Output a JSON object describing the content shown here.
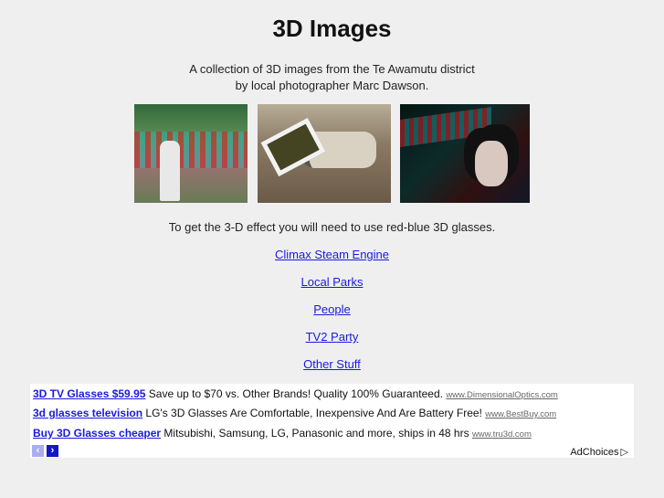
{
  "page": {
    "title": "3D Images",
    "intro_line1": "A collection of 3D images from the Te Awamutu district",
    "intro_line2": "by local photographer Marc Dawson.",
    "photos": [
      {
        "alt": "Anaglyph photo of person in front of steam engine"
      },
      {
        "alt": "3D glasses resting on a stereo camera"
      },
      {
        "alt": "Anaglyph portrait of a long-haired man"
      }
    ],
    "note": "To get the 3-D effect you will need to use red-blue 3D glasses.",
    "links": [
      "Climax Steam Engine",
      "Local Parks",
      "People",
      "TV2 Party",
      "Other Stuff"
    ]
  },
  "ads": {
    "items": [
      {
        "title": "3D TV Glasses $59.95",
        "text": "Save up to $70 vs. Other Brands! Quality 100% Guaranteed.",
        "url": "www.DimensionalOptics.com"
      },
      {
        "title": "3d glasses television",
        "text": "LG's 3D Glasses Are Comfortable, Inexpensive And Are Battery Free!",
        "url": "www.BestBuy.com"
      },
      {
        "title": "Buy 3D Glasses cheaper",
        "text": "Mitsubishi, Samsung, LG, Panasonic and more, ships in 48 hrs",
        "url": "www.tru3d.com"
      }
    ],
    "prev_icon": "‹",
    "next_icon": "›",
    "adchoices_label": "AdChoices",
    "adchoices_icon": "▷"
  },
  "colors": {
    "link": "#1a1ae0",
    "background": "#efefef",
    "ad_nav_active": "#1515c8",
    "ad_nav_inactive": "#a9aef0"
  }
}
